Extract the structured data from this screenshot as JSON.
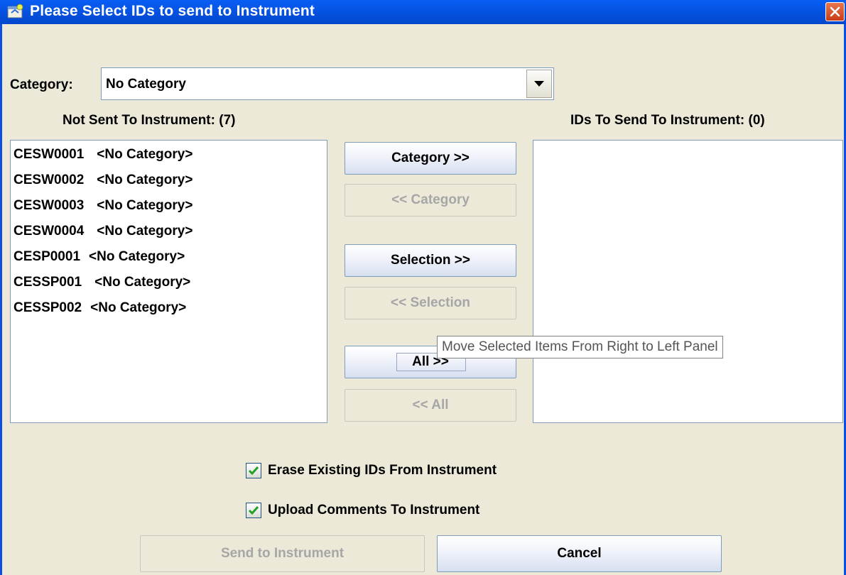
{
  "window": {
    "title": "Please Select IDs to send to Instrument",
    "title_icon": "java-app-icon",
    "close_icon": "close-x-icon"
  },
  "category": {
    "label": "Category:",
    "selected": "No Category",
    "dropdown_icon": "chevron-down-icon"
  },
  "left_list": {
    "header": "Not Sent To Instrument: (7)",
    "items": [
      {
        "id": "CESW0001",
        "category": "<No Category>"
      },
      {
        "id": "CESW0002",
        "category": "<No Category>"
      },
      {
        "id": "CESW0003",
        "category": "<No Category>"
      },
      {
        "id": "CESW0004",
        "category": "<No Category>"
      },
      {
        "id": "CESP0001",
        "category": "<No Category>"
      },
      {
        "id": "CESSP001",
        "category": "<No Category>"
      },
      {
        "id": "CESSP002",
        "category": "<No Category>"
      }
    ]
  },
  "right_list": {
    "header": "IDs To Send To Instrument: (0)",
    "items": []
  },
  "transfer_buttons": {
    "category_right": "Category >>",
    "category_left": "<< Category",
    "selection_right": "Selection >>",
    "selection_left": "<< Selection",
    "all_right": "All >>",
    "all_left": "<< All"
  },
  "tooltip": "Move Selected Items From Right to Left Panel",
  "options": {
    "erase_existing": {
      "label": "Erase Existing IDs From Instrument",
      "checked": true
    },
    "upload_comments": {
      "label": "Upload Comments To Instrument",
      "checked": true
    }
  },
  "footer": {
    "send_label": "Send to Instrument",
    "cancel_label": "Cancel"
  },
  "colors": {
    "title_bar": "#0553e2",
    "dialog_bg": "#ece9d8",
    "close_button": "#d9552c",
    "disabled_text": "#a6a6a6"
  }
}
